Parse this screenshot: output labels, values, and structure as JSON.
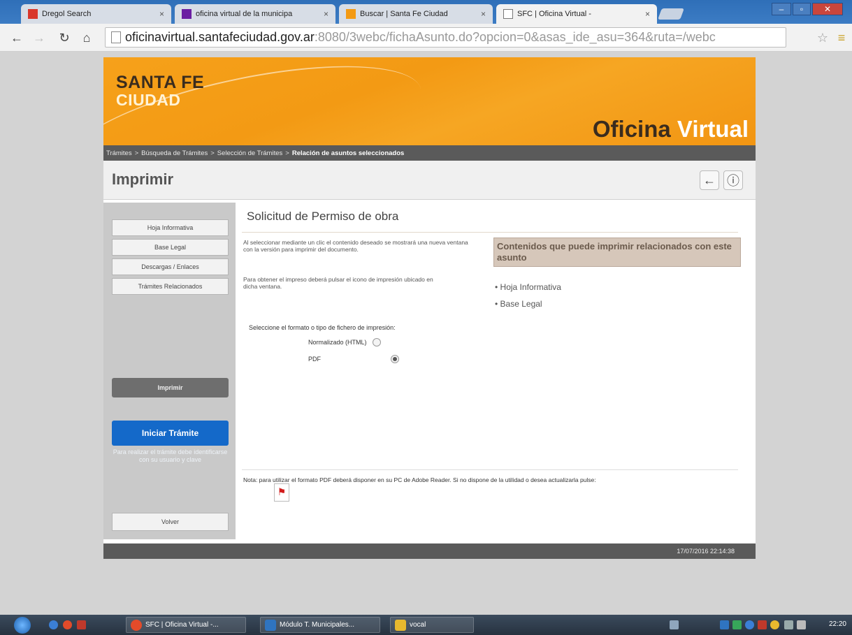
{
  "browser": {
    "tabs": [
      {
        "label": "Dregol Search",
        "icon": "dregol-icon",
        "color": "#d9372b"
      },
      {
        "label": "oficina virtual de la municipa",
        "icon": "yahoo-icon",
        "color": "#6b1fa2"
      },
      {
        "label": "Buscar | Santa Fe Ciudad",
        "icon": "santafe-icon",
        "color": "#f39a14"
      },
      {
        "label": "SFC | Oficina Virtual -",
        "icon": "page-icon",
        "color": "#ffffff"
      }
    ],
    "url_domain": "oficinavirtual.santafeciudad.gov.ar",
    "url_rest": ":8080/3webc/fichaAsunto.do?opcion=0&asas_ide_asu=364&ruta=/webc"
  },
  "header": {
    "logo_line1": "SANTA FE",
    "logo_line2": "CIUDAD",
    "title_word1": "Oficina",
    "title_word2": "Virtual",
    "brand_orange": "#f6a11a"
  },
  "breadcrumb": {
    "items": [
      "Trámites",
      "Búsqueda de Trámites",
      "Selección de Trámites"
    ],
    "current": "Relación de asuntos seleccionados",
    "separator": ">"
  },
  "printbar": {
    "title": "Imprimir",
    "back_icon": "←",
    "info_icon": "ⓘ"
  },
  "sidebar": {
    "links": [
      "Hoja Informativa",
      "Base Legal",
      "Descargas / Enlaces",
      "Trámites Relacionados"
    ],
    "imprimir_label": "Imprimir",
    "iniciar_label": "Iniciar Trámite",
    "iniciar_note": "Para realizar el trámite debe identificarse con su usuario y clave",
    "volver_label": "Volver",
    "accent": "#1469c9"
  },
  "main": {
    "title": "Solicitud de Permiso de obra",
    "info1": "Al seleccionar mediante un clic el contenido deseado se mostrará una nueva ventana con la versión para imprimir del documento.",
    "info2": "Para obtener el impreso deberá pulsar el icono de impresión ubicado en dicha ventana.",
    "contents_header": "Contenidos que puede imprimir relacionados con este asunto",
    "content_links": [
      "Hoja Informativa",
      "Base Legal"
    ],
    "format_label": "Seleccione el formato o tipo de fichero de impresión:",
    "formats": [
      {
        "label": "Normalizado (HTML)",
        "selected": false
      },
      {
        "label": "PDF",
        "selected": true
      }
    ],
    "note": "Nota: para utilizar el formato PDF deberá disponer en su PC de Adobe Reader. Si no dispone de la utilidad o desea actualizarla pulse:"
  },
  "footer": {
    "timestamp": "17/07/2016 22:14:38"
  },
  "taskbar": {
    "tasks": [
      "SFC | Oficina Virtual -...",
      "Módulo T. Municipales...",
      "vocal"
    ],
    "clock": "22:20"
  }
}
